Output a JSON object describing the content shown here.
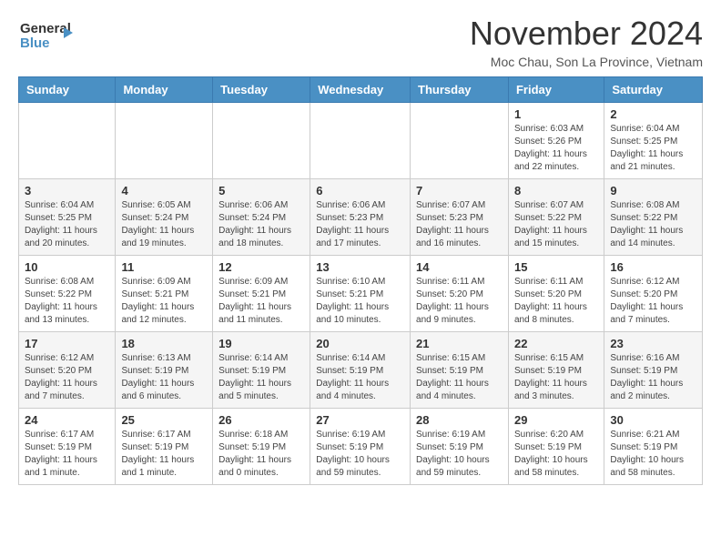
{
  "header": {
    "logo_line1": "General",
    "logo_line2": "Blue",
    "title": "November 2024",
    "location": "Moc Chau, Son La Province, Vietnam"
  },
  "days_of_week": [
    "Sunday",
    "Monday",
    "Tuesday",
    "Wednesday",
    "Thursday",
    "Friday",
    "Saturday"
  ],
  "weeks": [
    [
      {
        "day": "",
        "info": ""
      },
      {
        "day": "",
        "info": ""
      },
      {
        "day": "",
        "info": ""
      },
      {
        "day": "",
        "info": ""
      },
      {
        "day": "",
        "info": ""
      },
      {
        "day": "1",
        "info": "Sunrise: 6:03 AM\nSunset: 5:26 PM\nDaylight: 11 hours and 22 minutes."
      },
      {
        "day": "2",
        "info": "Sunrise: 6:04 AM\nSunset: 5:25 PM\nDaylight: 11 hours and 21 minutes."
      }
    ],
    [
      {
        "day": "3",
        "info": "Sunrise: 6:04 AM\nSunset: 5:25 PM\nDaylight: 11 hours and 20 minutes."
      },
      {
        "day": "4",
        "info": "Sunrise: 6:05 AM\nSunset: 5:24 PM\nDaylight: 11 hours and 19 minutes."
      },
      {
        "day": "5",
        "info": "Sunrise: 6:06 AM\nSunset: 5:24 PM\nDaylight: 11 hours and 18 minutes."
      },
      {
        "day": "6",
        "info": "Sunrise: 6:06 AM\nSunset: 5:23 PM\nDaylight: 11 hours and 17 minutes."
      },
      {
        "day": "7",
        "info": "Sunrise: 6:07 AM\nSunset: 5:23 PM\nDaylight: 11 hours and 16 minutes."
      },
      {
        "day": "8",
        "info": "Sunrise: 6:07 AM\nSunset: 5:22 PM\nDaylight: 11 hours and 15 minutes."
      },
      {
        "day": "9",
        "info": "Sunrise: 6:08 AM\nSunset: 5:22 PM\nDaylight: 11 hours and 14 minutes."
      }
    ],
    [
      {
        "day": "10",
        "info": "Sunrise: 6:08 AM\nSunset: 5:22 PM\nDaylight: 11 hours and 13 minutes."
      },
      {
        "day": "11",
        "info": "Sunrise: 6:09 AM\nSunset: 5:21 PM\nDaylight: 11 hours and 12 minutes."
      },
      {
        "day": "12",
        "info": "Sunrise: 6:09 AM\nSunset: 5:21 PM\nDaylight: 11 hours and 11 minutes."
      },
      {
        "day": "13",
        "info": "Sunrise: 6:10 AM\nSunset: 5:21 PM\nDaylight: 11 hours and 10 minutes."
      },
      {
        "day": "14",
        "info": "Sunrise: 6:11 AM\nSunset: 5:20 PM\nDaylight: 11 hours and 9 minutes."
      },
      {
        "day": "15",
        "info": "Sunrise: 6:11 AM\nSunset: 5:20 PM\nDaylight: 11 hours and 8 minutes."
      },
      {
        "day": "16",
        "info": "Sunrise: 6:12 AM\nSunset: 5:20 PM\nDaylight: 11 hours and 7 minutes."
      }
    ],
    [
      {
        "day": "17",
        "info": "Sunrise: 6:12 AM\nSunset: 5:20 PM\nDaylight: 11 hours and 7 minutes."
      },
      {
        "day": "18",
        "info": "Sunrise: 6:13 AM\nSunset: 5:19 PM\nDaylight: 11 hours and 6 minutes."
      },
      {
        "day": "19",
        "info": "Sunrise: 6:14 AM\nSunset: 5:19 PM\nDaylight: 11 hours and 5 minutes."
      },
      {
        "day": "20",
        "info": "Sunrise: 6:14 AM\nSunset: 5:19 PM\nDaylight: 11 hours and 4 minutes."
      },
      {
        "day": "21",
        "info": "Sunrise: 6:15 AM\nSunset: 5:19 PM\nDaylight: 11 hours and 4 minutes."
      },
      {
        "day": "22",
        "info": "Sunrise: 6:15 AM\nSunset: 5:19 PM\nDaylight: 11 hours and 3 minutes."
      },
      {
        "day": "23",
        "info": "Sunrise: 6:16 AM\nSunset: 5:19 PM\nDaylight: 11 hours and 2 minutes."
      }
    ],
    [
      {
        "day": "24",
        "info": "Sunrise: 6:17 AM\nSunset: 5:19 PM\nDaylight: 11 hours and 1 minute."
      },
      {
        "day": "25",
        "info": "Sunrise: 6:17 AM\nSunset: 5:19 PM\nDaylight: 11 hours and 1 minute."
      },
      {
        "day": "26",
        "info": "Sunrise: 6:18 AM\nSunset: 5:19 PM\nDaylight: 11 hours and 0 minutes."
      },
      {
        "day": "27",
        "info": "Sunrise: 6:19 AM\nSunset: 5:19 PM\nDaylight: 10 hours and 59 minutes."
      },
      {
        "day": "28",
        "info": "Sunrise: 6:19 AM\nSunset: 5:19 PM\nDaylight: 10 hours and 59 minutes."
      },
      {
        "day": "29",
        "info": "Sunrise: 6:20 AM\nSunset: 5:19 PM\nDaylight: 10 hours and 58 minutes."
      },
      {
        "day": "30",
        "info": "Sunrise: 6:21 AM\nSunset: 5:19 PM\nDaylight: 10 hours and 58 minutes."
      }
    ]
  ]
}
